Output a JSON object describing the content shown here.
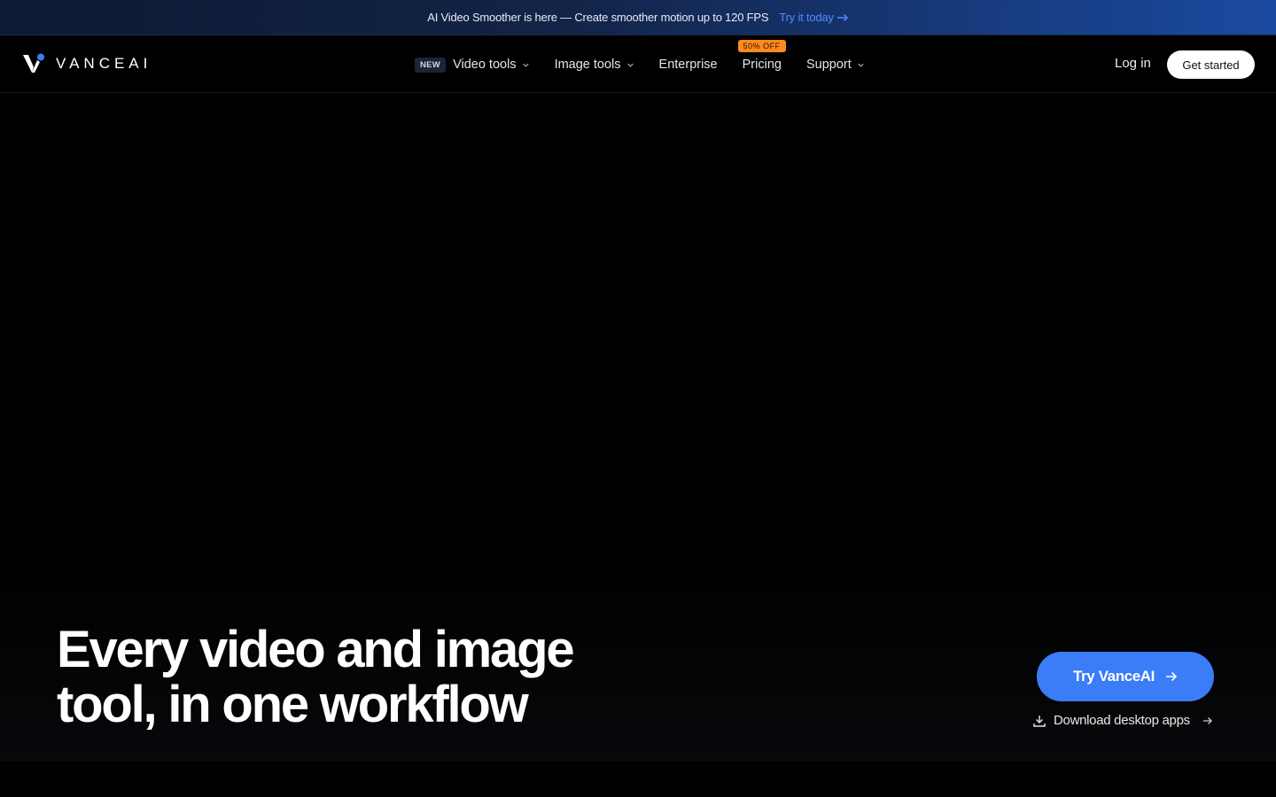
{
  "announcement": {
    "message": "AI Video Smoother is here — Create smoother motion up to 120 FPS",
    "cta": "Try it today"
  },
  "brand": {
    "name": "VANCEAI",
    "accent": "#3b7cf7"
  },
  "nav": {
    "video_tools": {
      "badge": "NEW",
      "label": "Video tools"
    },
    "image_tools": {
      "label": "Image tools"
    },
    "enterprise": {
      "label": "Enterprise"
    },
    "pricing": {
      "badge": "50% OFF",
      "label": "Pricing"
    },
    "support": {
      "label": "Support"
    }
  },
  "auth": {
    "login": "Log in",
    "get_started": "Get started"
  },
  "hero": {
    "headline_line1": "Every video and image",
    "headline_line2": "tool, in one workflow",
    "primary_cta": "Try VanceAI",
    "secondary_cta": "Download desktop apps"
  }
}
